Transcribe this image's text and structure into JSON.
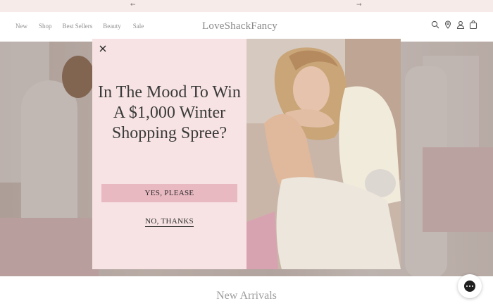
{
  "announcement": {
    "prev_icon": "arrow-left-icon",
    "next_icon": "arrow-right-icon",
    "prev_glyph": "←",
    "next_glyph": "→"
  },
  "header": {
    "nav": [
      "New",
      "Shop",
      "Best Sellers",
      "Beauty",
      "Sale"
    ],
    "logo": "LoveShackFancy",
    "icons": [
      "search-icon",
      "location-pin-icon",
      "account-icon",
      "shopping-bag-icon"
    ]
  },
  "modal": {
    "close_icon": "close-icon",
    "headline": "In The Mood To Win A $1,000 Winter Shopping Spree?",
    "yes_label": "YES, PLEASE",
    "no_label": "NO, THANKS",
    "image_description_icon": "model-photo"
  },
  "main": {
    "section_title": "New Arrivals"
  },
  "chat": {
    "icon": "chat-icon"
  },
  "colors": {
    "announcement_bg": "#f6ebe9",
    "modal_bg": "#f7e3e3",
    "button_bg": "#e9b9c2",
    "text": "#2b2b2b"
  }
}
